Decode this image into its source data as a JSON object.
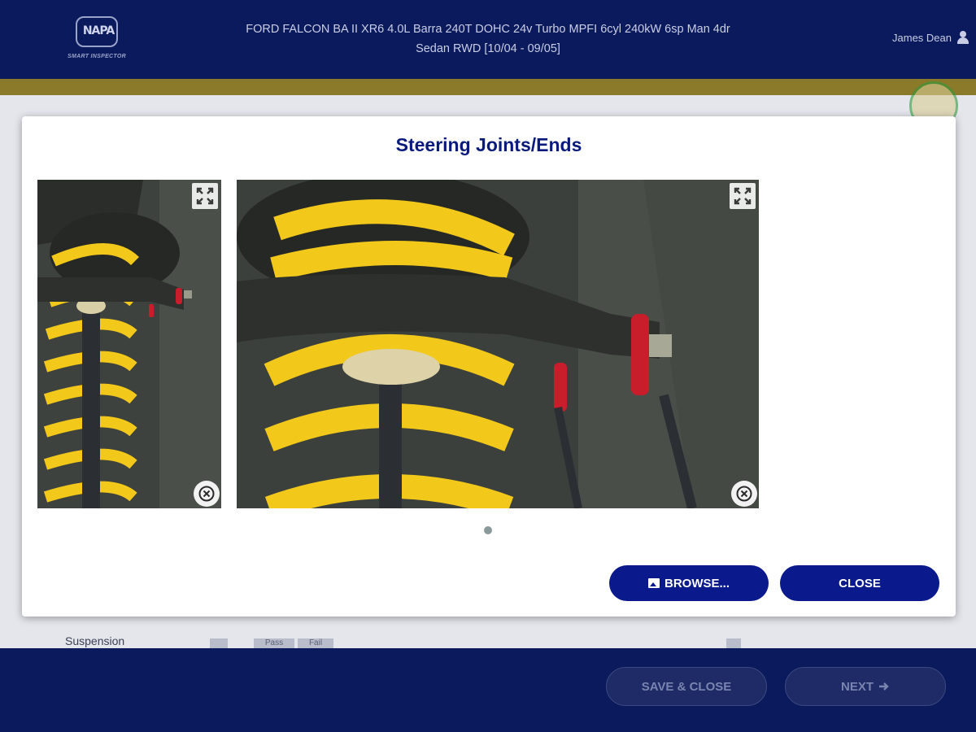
{
  "header": {
    "logo_text": "NAPA",
    "logo_sub": "SMART INSPECTOR",
    "vehicle_line1": "FORD FALCON BA II XR6 4.0L Barra 240T DOHC 24v Turbo MPFI 6cyl 240kW 6sp Man 4dr",
    "vehicle_line2": "Sedan RWD [10/04 - 09/05]",
    "user_name": "James Dean"
  },
  "background": {
    "row_label": "Suspension",
    "pass_label": "Pass",
    "fail_label": "Fail"
  },
  "modal": {
    "title": "Steering Joints/Ends",
    "browse_label": "BROWSE...",
    "close_label": "CLOSE",
    "photos": [
      {
        "name": "suspension-photo-1"
      },
      {
        "name": "suspension-photo-2"
      }
    ]
  },
  "footer": {
    "save_close_label": "SAVE & CLOSE",
    "next_label": "NEXT"
  },
  "colors": {
    "navy": "#0a1a5c",
    "button_blue": "#0a1a8c",
    "title_blue": "#0a1a7c",
    "gold": "#8a7a2a",
    "spring_yellow": "#f2c81a",
    "bushing_red": "#c81e2c"
  },
  "icons": [
    "user-icon",
    "expand-icon",
    "delete-icon",
    "image-icon",
    "arrow-right-icon"
  ]
}
